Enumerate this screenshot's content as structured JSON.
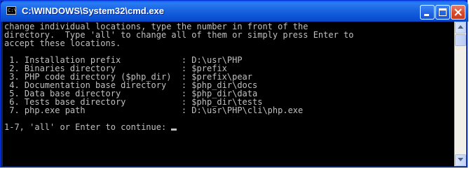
{
  "window": {
    "title": "C:\\WINDOWS\\System32\\cmd.exe",
    "icon": "console-icon",
    "icon_text": "C:\\"
  },
  "console": {
    "lines": [
      "change individual locations, type the number in front of the",
      "directory.  Type 'all' to change all of them or simply press Enter to",
      "accept these locations.",
      "",
      " 1. Installation prefix            : D:\\usr\\PHP",
      " 2. Binaries directory             : $prefix",
      " 3. PHP code directory ($php_dir)  : $prefix\\pear",
      " 4. Documentation base directory   : $php_dir\\docs",
      " 5. Data base directory            : $php_dir\\data",
      " 6. Tests base directory           : $php_dir\\tests",
      " 7. php.exe path                   : D:\\usr\\PHP\\cli\\php.exe",
      ""
    ],
    "prompt": "1-7, 'all' or Enter to continue: "
  },
  "colors": {
    "console_bg": "#000000",
    "console_fg": "#c0c0c0",
    "titlebar": "#0b52d6"
  }
}
